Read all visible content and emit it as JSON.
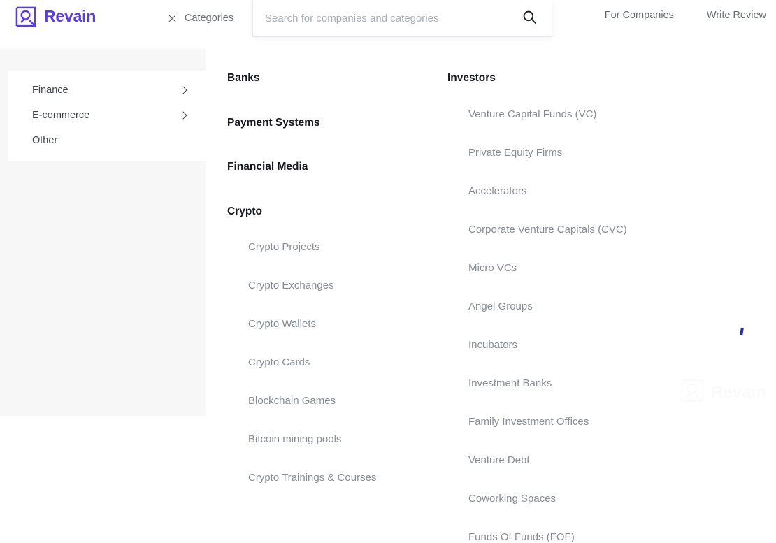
{
  "brand": {
    "name": "Revain",
    "logo_icon": "revain-logo-icon",
    "accent_color": "#5b3ce0",
    "watermark_color": "#fafafa"
  },
  "header": {
    "categories_toggle": {
      "label": "Categories",
      "icon": "close-x-icon",
      "state": "open"
    },
    "search": {
      "placeholder": "Search for companies and categories",
      "value": "",
      "icon": "search-icon"
    },
    "links": [
      {
        "label": "For Companies"
      },
      {
        "label": "Write Review"
      }
    ]
  },
  "sidebar": {
    "items": [
      {
        "label": "Finance",
        "has_children": true,
        "icon": "chevron-right-icon"
      },
      {
        "label": "E-commerce",
        "has_children": true,
        "icon": "chevron-right-icon"
      },
      {
        "label": "Other",
        "has_children": false,
        "icon": ""
      }
    ]
  },
  "columns": [
    {
      "groups": [
        {
          "title": "Banks",
          "items": []
        },
        {
          "title": "Payment Systems",
          "items": []
        },
        {
          "title": "Financial Media",
          "items": []
        },
        {
          "title": "Crypto",
          "items": [
            "Crypto Projects",
            "Crypto Exchanges",
            "Crypto Wallets",
            "Crypto Cards",
            "Blockchain Games",
            "Bitcoin mining pools",
            "Crypto Trainings & Courses"
          ]
        }
      ]
    },
    {
      "groups": [
        {
          "title": "Investors",
          "items": [
            "Venture Capital Funds (VC)",
            "Private Equity Firms",
            "Accelerators",
            "Corporate Venture Capitals (CVC)",
            "Micro VCs",
            "Angel Groups",
            "Incubators",
            "Investment Banks",
            "Family Investment Offices",
            "Venture Debt",
            "Coworking Spaces",
            "Funds Of Funds (FOF)"
          ]
        }
      ]
    }
  ],
  "watermark": {
    "label": "Revain",
    "icon": "revain-logo-icon"
  }
}
